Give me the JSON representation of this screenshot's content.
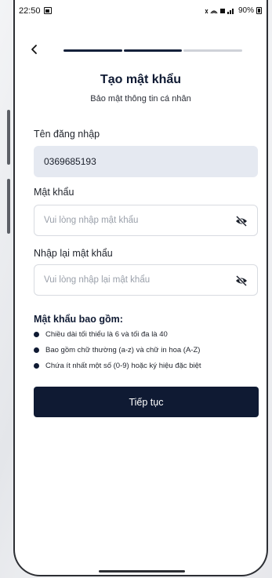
{
  "status_bar": {
    "time": "22:50",
    "right_icons": "✖̶ ≡ ∥",
    "battery": "90%"
  },
  "header": {
    "title": "Tạo mật khẩu",
    "subtitle": "Bảo mật thông tin cá nhân",
    "progress": {
      "total_steps": 3,
      "completed_steps": 2
    }
  },
  "form": {
    "username": {
      "label": "Tên đăng nhập",
      "value": "0369685193"
    },
    "password": {
      "label": "Mật khẩu",
      "placeholder": "Vui lòng nhập mật khẩu"
    },
    "confirm_password": {
      "label": "Nhập lại mật khẩu",
      "placeholder": "Vui lòng nhập lại mật khẩu"
    }
  },
  "rules": {
    "title": "Mật khẩu bao gồm:",
    "items": [
      "Chiều dài tối thiểu là 6 và tối đa là 40",
      "Bao gồm chữ thường (a-z) và chữ in hoa (A-Z)",
      "Chứa ít nhất một số (0-9) hoặc ký hiệu đặc biệt"
    ]
  },
  "actions": {
    "continue_label": "Tiếp tục"
  },
  "colors": {
    "primary": "#0f1a33",
    "filled_field_bg": "#e5e9f1",
    "progress_inactive": "#cfd2d8"
  },
  "icons": {
    "back": "chevron-left-icon",
    "toggle_visibility": "eye-slash-icon",
    "bullet": "dot-icon"
  }
}
